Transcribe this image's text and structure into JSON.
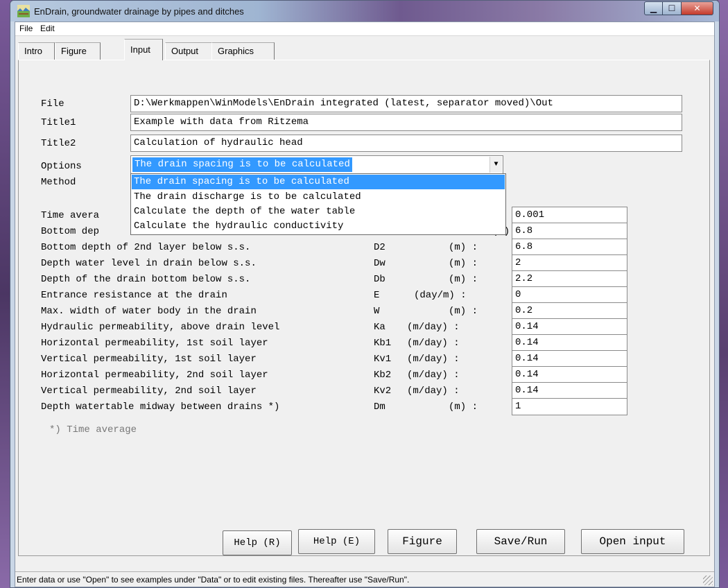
{
  "window": {
    "title": "EnDrain, groundwater drainage by pipes and ditches",
    "icon": "endrain-app-icon"
  },
  "menu": {
    "file": "File",
    "edit": "Edit"
  },
  "tabs": [
    "Intro",
    "Figure",
    "Input",
    "Output",
    "Graphics"
  ],
  "active_tab": "Input",
  "form": {
    "file_label": "File",
    "file_value": "D:\\Werkmappen\\WinModels\\EnDrain integrated (latest, separator moved)\\Out",
    "title1_label": "Title1",
    "title1_value": "Example with data from Ritzema",
    "title2_label": "Title2",
    "title2_value": "Calculation of hydraulic head",
    "options_label": "Options",
    "options_value": "The drain spacing is to be calculated",
    "method_label": "Method",
    "options_list": [
      "The drain spacing is to be calculated",
      "The drain discharge is to be calculated",
      "Calculate the depth of the water table",
      "Calculate the hydraulic conductivity"
    ]
  },
  "params": [
    {
      "label": "Time avera",
      "sym": "",
      "unit": "",
      "value": "0.001"
    },
    {
      "label": "Bottom dep",
      "sym": "",
      "unit": "",
      "value": "6.8"
    },
    {
      "label": "Bottom depth of 2nd layer below s.s.",
      "sym": "D2",
      "unit": "(m) :",
      "value": "6.8"
    },
    {
      "label": "Depth water level in drain below s.s.",
      "sym": "Dw",
      "unit": "(m) :",
      "value": "2"
    },
    {
      "label": "Depth of the drain bottom below s.s.",
      "sym": "Db",
      "unit": "(m) :",
      "value": "2.2"
    },
    {
      "label": "Entrance resistance at the drain",
      "sym": "E",
      "unit": "(day/m) :",
      "value": "0"
    },
    {
      "label": "Max. width of water body in the drain",
      "sym": "W",
      "unit": "(m) :",
      "value": "0.2"
    },
    {
      "label": "Hydraulic permeability, above drain level",
      "sym": "Ka",
      "unit": "(m/day) :",
      "value": "0.14"
    },
    {
      "label": "Horizontal permeability, 1st soil layer",
      "sym": "Kb1",
      "unit": "(m/day) :",
      "value": "0.14"
    },
    {
      "label": "Vertical permeability, 1st soil layer",
      "sym": "Kv1",
      "unit": "(m/day) :",
      "value": "0.14"
    },
    {
      "label": "Horizontal permeability, 2nd soil layer",
      "sym": "Kb2",
      "unit": "(m/day) :",
      "value": "0.14"
    },
    {
      "label": "Vertical permeability, 2nd soil layer",
      "sym": "Kv2",
      "unit": "(m/day) :",
      "value": "0.14"
    },
    {
      "label": "Depth watertable midway between drains *)",
      "sym": "Dm",
      "unit": "(m) :",
      "value": "1"
    }
  ],
  "partial_unit": "(m)",
  "note": "*) Time average",
  "buttons": {
    "help_r": "Help (R)",
    "help_e": "Help (E)",
    "figure": "Figure",
    "save_run": "Save/Run",
    "open_input": "Open input"
  },
  "status": "Enter data or use \"Open\" to see examples under \"Data\" or to edit existing files. Thereafter use \"Save/Run\"."
}
